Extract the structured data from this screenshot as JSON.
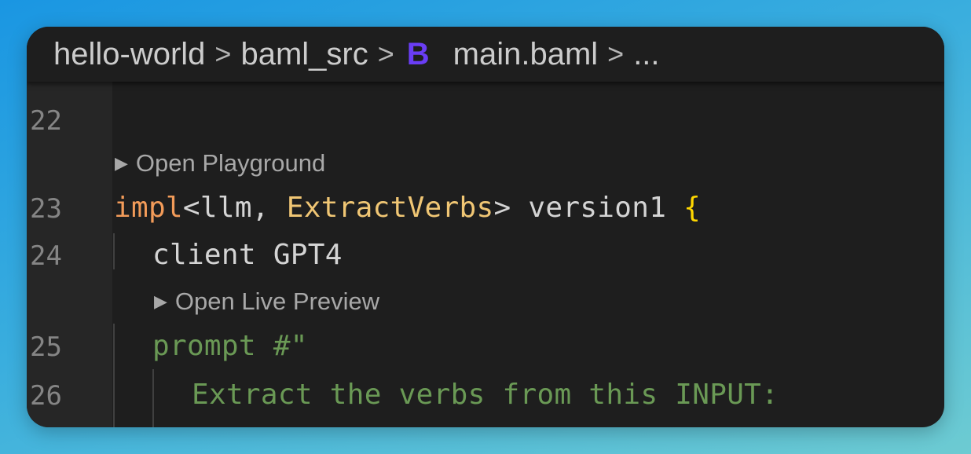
{
  "breadcrumb": {
    "items": [
      "hello-world",
      "baml_src",
      "main.baml",
      "..."
    ],
    "separator": ">",
    "file_icon": "B",
    "file_icon_color": "#6a3df5"
  },
  "editor": {
    "lines": [
      {
        "number": "22",
        "text": ""
      },
      {
        "number": "23",
        "keyword": "impl",
        "open": "<",
        "param": "llm, ",
        "type": "ExtractVerbs",
        "close": "> version1 ",
        "brace": "{"
      },
      {
        "number": "24",
        "text": "client GPT4"
      },
      {
        "number": "25",
        "text": "prompt #\""
      },
      {
        "number": "26",
        "text": "Extract the verbs from this INPUT:"
      }
    ],
    "code_lenses": [
      {
        "label": "Open Playground",
        "icon": "play-triangle-icon"
      },
      {
        "label": "Open Live Preview",
        "icon": "play-triangle-icon"
      }
    ]
  },
  "colors": {
    "keyword": "#f29b59",
    "type": "#f0c674",
    "brace": "#ffd700",
    "string": "#6a9955",
    "text": "#d4d4d4"
  }
}
